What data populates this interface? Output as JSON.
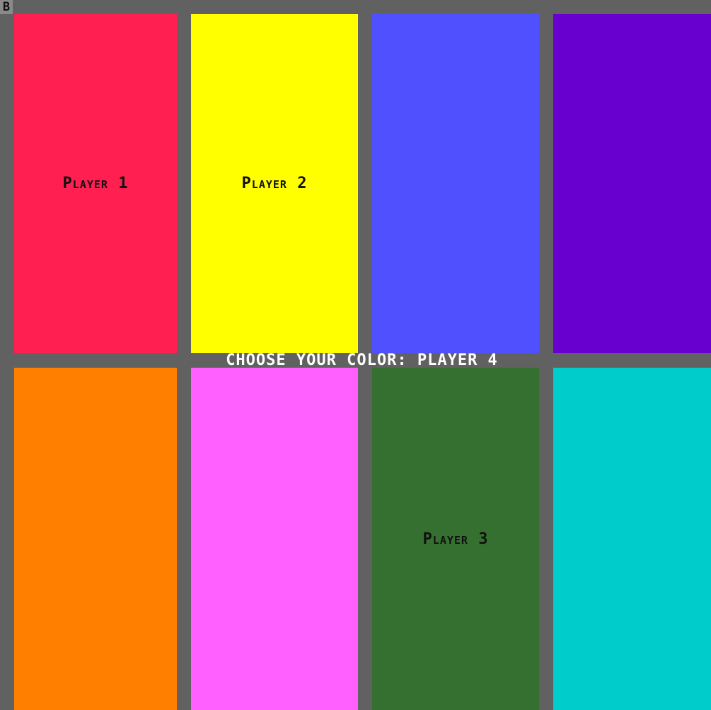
{
  "corner_label": "B",
  "prompt": "CHOOSE YOUR COLOR: PLAYER 4",
  "swatches": [
    {
      "color": "#ff1f50",
      "label": "Player 1"
    },
    {
      "color": "#ffff00",
      "label": "Player 2"
    },
    {
      "color": "#5050ff",
      "label": ""
    },
    {
      "color": "#6800d0",
      "label": ""
    },
    {
      "color": "#ff8000",
      "label": ""
    },
    {
      "color": "#ff60ff",
      "label": ""
    },
    {
      "color": "#367030",
      "label": "Player 3"
    },
    {
      "color": "#00cccc",
      "label": ""
    }
  ]
}
